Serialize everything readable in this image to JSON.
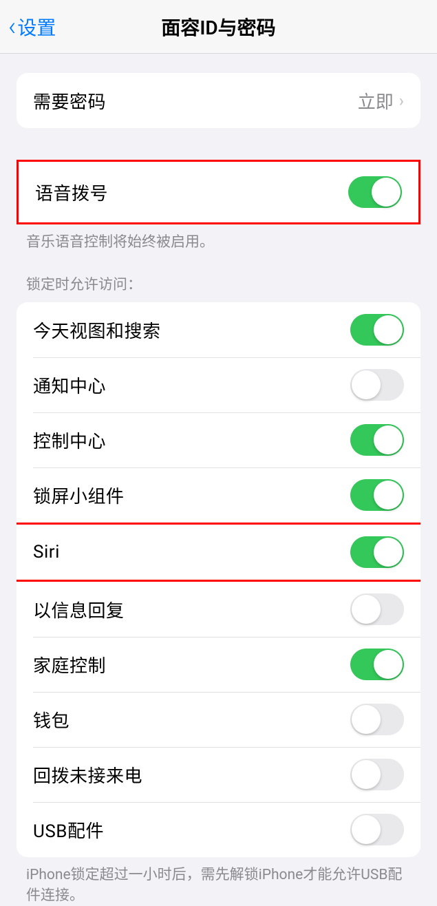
{
  "header": {
    "back_label": "设置",
    "title": "面容ID与密码"
  },
  "passcode": {
    "require_label": "需要密码",
    "require_value": "立即"
  },
  "voice_dial": {
    "label": "语音拨号",
    "enabled": true,
    "footer": "音乐语音控制将始终被启用。"
  },
  "lock_access": {
    "header": "锁定时允许访问：",
    "items": [
      {
        "label": "今天视图和搜索",
        "enabled": true
      },
      {
        "label": "通知中心",
        "enabled": false
      },
      {
        "label": "控制中心",
        "enabled": true
      },
      {
        "label": "锁屏小组件",
        "enabled": true
      },
      {
        "label": "Siri",
        "enabled": true
      },
      {
        "label": "以信息回复",
        "enabled": false
      },
      {
        "label": "家庭控制",
        "enabled": true
      },
      {
        "label": "钱包",
        "enabled": false
      },
      {
        "label": "回拨未接来电",
        "enabled": false
      },
      {
        "label": "USB配件",
        "enabled": false
      }
    ],
    "footer": "iPhone锁定超过一小时后，需先解锁iPhone才能允许USB配件连接。"
  }
}
